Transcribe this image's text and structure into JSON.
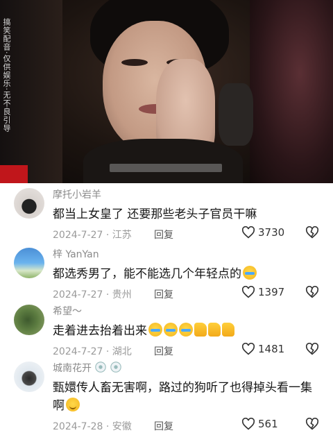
{
  "video": {
    "watermark": "搞笑配音·仅供娱乐·无不良引导"
  },
  "comments": [
    {
      "user": "摩托小岩羊",
      "text": "都当上女皇了 还要那些老头子官员干嘛",
      "date_location": "2024-7-27 · 江苏",
      "reply_label": "回复",
      "likes": "3730",
      "emojis": []
    },
    {
      "user": "梓 YanYan",
      "text": "都选秀男了，能不能选几个年轻点的",
      "date_location": "2024-7-27 · 贵州",
      "reply_label": "回复",
      "likes": "1397",
      "emojis": [
        "crying-laughing"
      ]
    },
    {
      "user": "希望～",
      "text": "走着进去抬着出来",
      "date_location": "2024-7-27 · 湖北",
      "reply_label": "回复",
      "likes": "1481",
      "emojis": [
        "crying-laughing",
        "crying-laughing",
        "crying-laughing",
        "thumbs-up",
        "thumbs-up",
        "thumbs-up"
      ]
    },
    {
      "user": "城南花开",
      "text": "甄嬛传人畜无害啊，路过的狗听了也得掉头看一集啊",
      "date_location": "2024-7-28 · 安徽",
      "reply_label": "回复",
      "likes": "561",
      "emojis": [
        "smile"
      ]
    }
  ]
}
